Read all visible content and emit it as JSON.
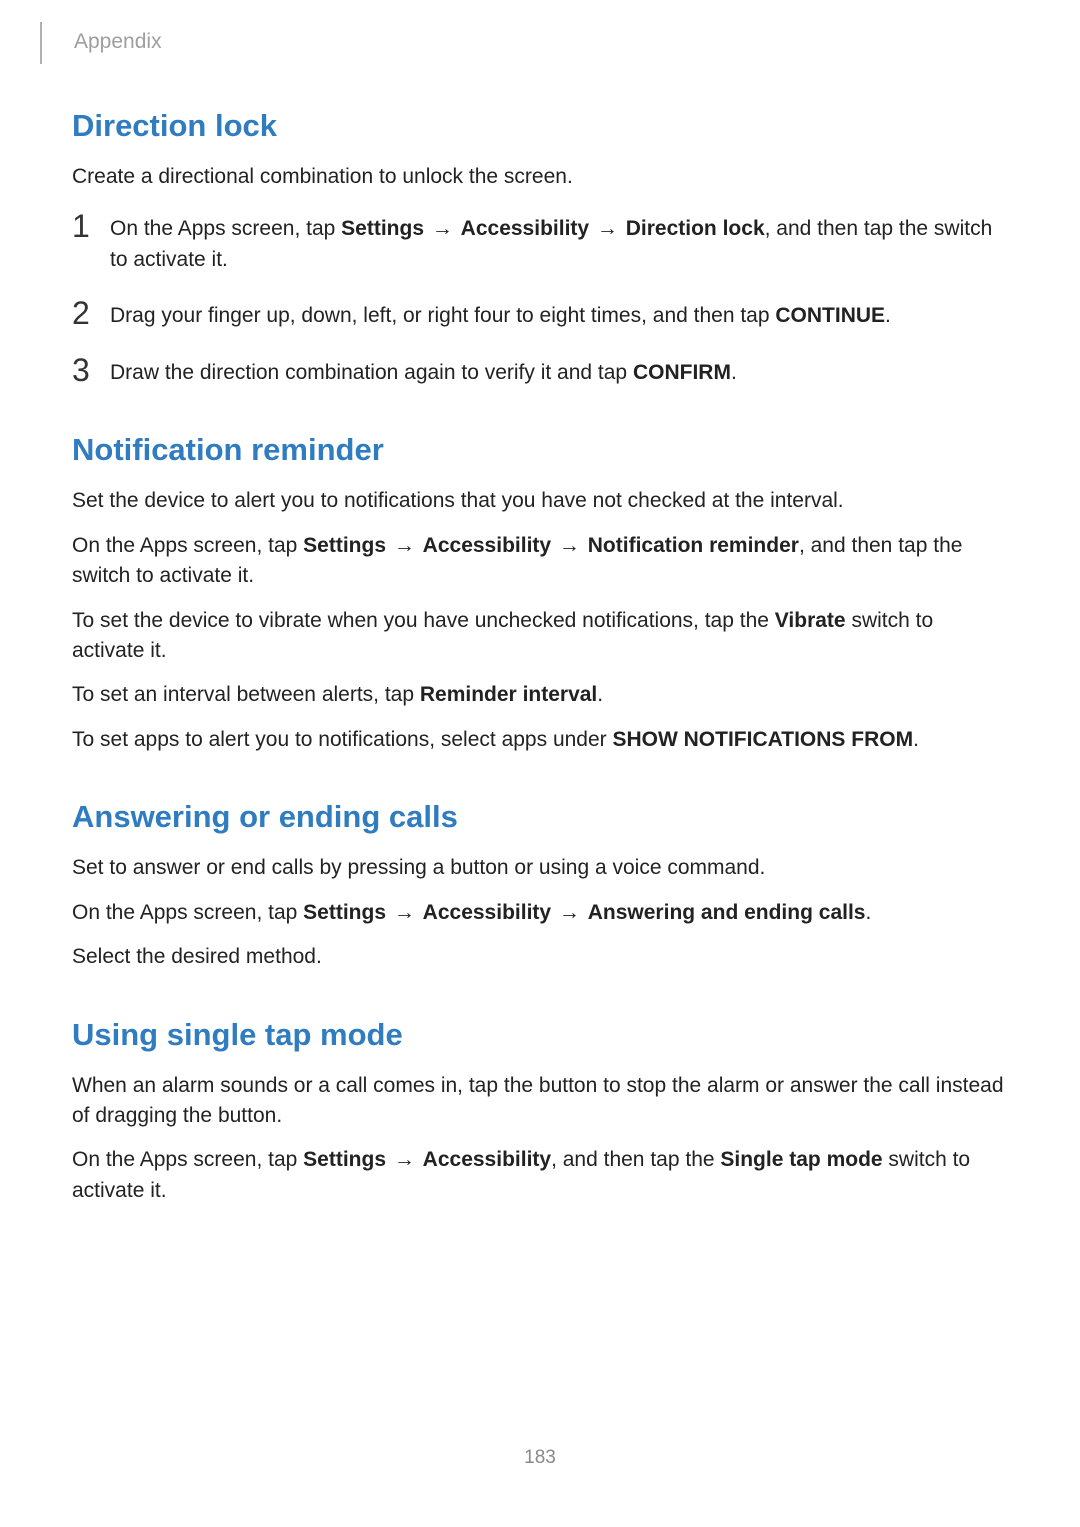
{
  "header": {
    "section": "Appendix"
  },
  "page_number": "183",
  "sections": {
    "direction_lock": {
      "heading": "Direction lock",
      "intro": "Create a directional combination to unlock the screen.",
      "steps": {
        "1": {
          "num": "1",
          "pre": "On the Apps screen, tap ",
          "b1": "Settings",
          "arr1": " → ",
          "b2": "Accessibility",
          "arr2": " → ",
          "b3": "Direction lock",
          "post": ", and then tap the switch to activate it."
        },
        "2": {
          "num": "2",
          "pre": "Drag your finger up, down, left, or right four to eight times, and then tap ",
          "b1": "CONTINUE",
          "post": "."
        },
        "3": {
          "num": "3",
          "pre": "Draw the direction combination again to verify it and tap ",
          "b1": "CONFIRM",
          "post": "."
        }
      }
    },
    "notification_reminder": {
      "heading": "Notification reminder",
      "p1": "Set the device to alert you to notifications that you have not checked at the interval.",
      "p2": {
        "pre": "On the Apps screen, tap ",
        "b1": "Settings",
        "arr1": " → ",
        "b2": "Accessibility",
        "arr2": " → ",
        "b3": "Notification reminder",
        "post": ", and then tap the switch to activate it."
      },
      "p3": {
        "pre": "To set the device to vibrate when you have unchecked notifications, tap the ",
        "b1": "Vibrate",
        "post": " switch to activate it."
      },
      "p4": {
        "pre": "To set an interval between alerts, tap ",
        "b1": "Reminder interval",
        "post": "."
      },
      "p5": {
        "pre": "To set apps to alert you to notifications, select apps under ",
        "b1": "SHOW NOTIFICATIONS FROM",
        "post": "."
      }
    },
    "answering_calls": {
      "heading": "Answering or ending calls",
      "p1": "Set to answer or end calls by pressing a button or using a voice command.",
      "p2": {
        "pre": "On the Apps screen, tap ",
        "b1": "Settings",
        "arr1": " → ",
        "b2": "Accessibility",
        "arr2": " → ",
        "b3": "Answering and ending calls",
        "post": "."
      },
      "p3": "Select the desired method."
    },
    "single_tap": {
      "heading": "Using single tap mode",
      "p1": "When an alarm sounds or a call comes in, tap the button to stop the alarm or answer the call instead of dragging the button.",
      "p2": {
        "pre": "On the Apps screen, tap ",
        "b1": "Settings",
        "arr1": " → ",
        "b2": "Accessibility",
        "post1": ", and then tap the ",
        "b3": "Single tap mode",
        "post2": " switch to activate it."
      }
    }
  }
}
